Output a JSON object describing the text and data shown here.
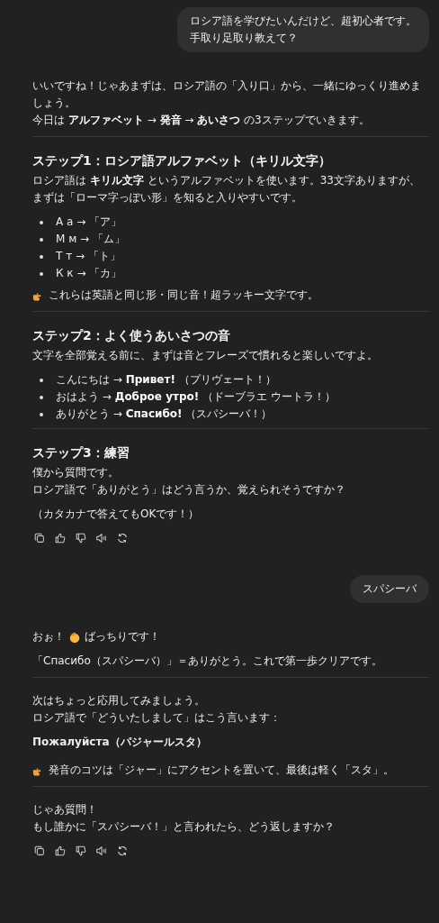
{
  "messages": [
    {
      "kind": "user",
      "lines": [
        "ロシア語を学びたいんだけど、超初心者です。",
        "手取り足取り教えて？"
      ]
    },
    {
      "kind": "assistant",
      "actions": true,
      "blocks": [
        {
          "kind": "paragraph",
          "lines": [
            "いいですね！じゃあまずは、ロシア語の「入り口」から、一緒にゆっくり進めましょう。",
            "今日は **アルファベット** → **発音** → **あいさつ** の3ステップでいきます。"
          ]
        },
        {
          "kind": "divider"
        },
        {
          "kind": "heading",
          "text": "ステップ1：ロシア語アルファベット（キリル文字）"
        },
        {
          "kind": "paragraph",
          "lines": [
            "ロシア語は **キリル文字** というアルファベットを使います。33文字ありますが、まずは「ローマ字っぽい形」を知ると入りやすいです。"
          ]
        },
        {
          "kind": "list",
          "items": [
            "А а → 「ア」",
            "М м → 「ム」",
            "Т т → 「ト」",
            "К к → 「カ」"
          ]
        },
        {
          "kind": "pointer_note",
          "after": "これらは英語と同じ形・同じ音！超ラッキー文字です。"
        },
        {
          "kind": "divider"
        },
        {
          "kind": "heading",
          "text": "ステップ2：よく使うあいさつの音"
        },
        {
          "kind": "paragraph",
          "lines": [
            "文字を全部覚える前に、まずは音とフレーズで慣れると楽しいですよ。"
          ]
        },
        {
          "kind": "list",
          "items": [
            "こんにちは → **Привет!** （プリヴェート！）",
            "おはよう → **Доброе утро!** （ドーブラエ ウートラ！）",
            "ありがとう → **Спасибо!** （スパシーバ！）"
          ]
        },
        {
          "kind": "divider"
        },
        {
          "kind": "heading",
          "text": "ステップ3：練習"
        },
        {
          "kind": "paragraph",
          "lines": [
            "僕から質問です。",
            "ロシア語で「ありがとう」はどう言うか、覚えられそうですか？"
          ]
        },
        {
          "kind": "paragraph",
          "lines": [
            "（カタカナで答えてもOKです！）"
          ]
        }
      ]
    },
    {
      "kind": "user",
      "lines": [
        "スパシーバ"
      ]
    },
    {
      "kind": "assistant",
      "actions": true,
      "blocks": [
        {
          "kind": "clap_line",
          "before": "おぉ！",
          "after": "ばっちりです！"
        },
        {
          "kind": "paragraph",
          "lines": [
            "「Спасибо（スパシーバ）」＝ありがとう。これで第一歩クリアです。"
          ]
        },
        {
          "kind": "divider"
        },
        {
          "kind": "paragraph",
          "lines": [
            "次はちょっと応用してみましょう。",
            "ロシア語で「どういたしまして」はこう言います："
          ]
        },
        {
          "kind": "strong",
          "text": "Пожалуйста（パジャールスタ）"
        },
        {
          "kind": "pointer_note",
          "after": "発音のコツは「ジャー」にアクセントを置いて、最後は軽く「スタ」。"
        },
        {
          "kind": "divider"
        },
        {
          "kind": "paragraph",
          "lines": [
            "じゃあ質問！",
            "もし誰かに「スパシーバ！」と言われたら、どう返しますか？"
          ]
        }
      ]
    }
  ]
}
